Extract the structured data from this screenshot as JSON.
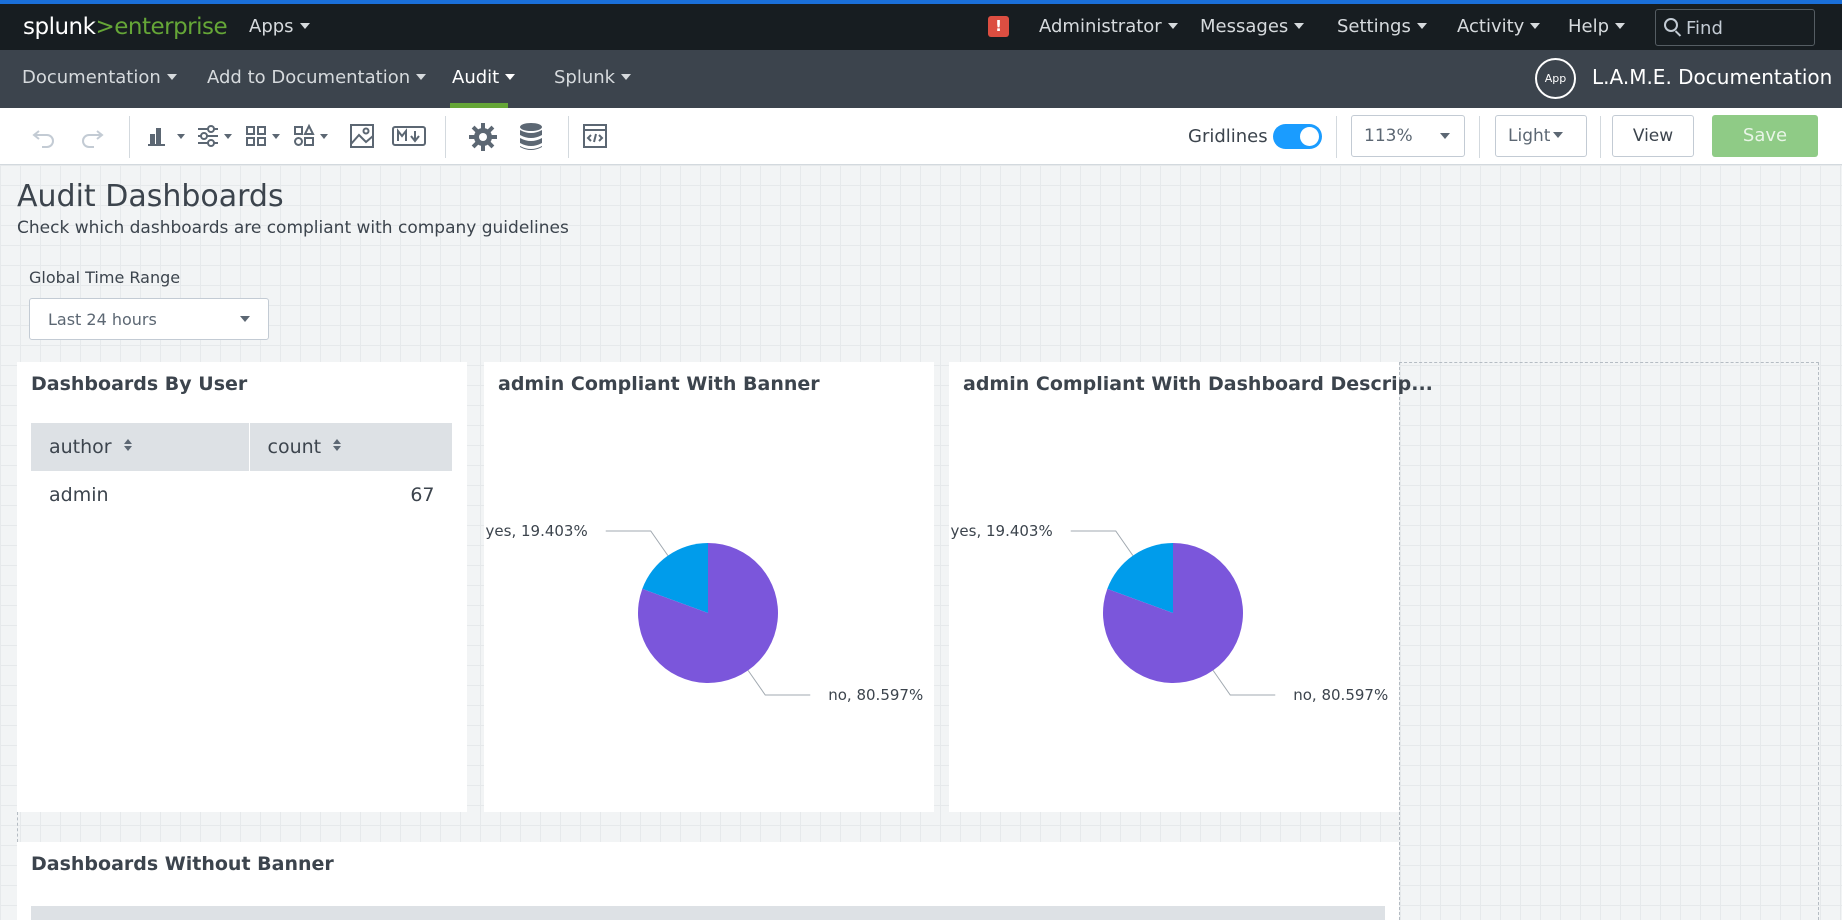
{
  "topbar": {
    "logo_splunk": "splunk",
    "logo_gt": ">",
    "logo_enterprise": "enterprise",
    "apps": "Apps",
    "alert_icon": "!",
    "administrator": "Administrator",
    "messages": "Messages",
    "settings": "Settings",
    "activity": "Activity",
    "help": "Help",
    "find_placeholder": "Find"
  },
  "appbar": {
    "items": [
      "Documentation",
      "Add to Documentation",
      "Audit",
      "Splunk"
    ],
    "active": "Audit",
    "app_badge": "App",
    "app_title": "L.A.M.E. Documentation"
  },
  "toolbar": {
    "icons": [
      "undo-icon",
      "redo-icon",
      "add-chart-icon",
      "add-input-icon",
      "layout-icon",
      "shapes-icon",
      "image-icon",
      "markdown-icon",
      "settings-icon",
      "datasource-icon",
      "source-code-icon"
    ],
    "gridlines_label": "Gridlines",
    "gridlines_on": true,
    "zoom": "113%",
    "theme": "Light",
    "view_label": "View",
    "save_label": "Save"
  },
  "dashboard": {
    "title": "Audit Dashboards",
    "description": "Check which dashboards are compliant with company guidelines",
    "time_input_label": "Global Time Range",
    "time_input_value": "Last 24 hours"
  },
  "panels": {
    "users": {
      "title": "Dashboards By User",
      "columns": [
        "author",
        "count"
      ],
      "rows": [
        [
          "admin",
          "67"
        ]
      ]
    },
    "banner": {
      "title": "admin Compliant With Banner"
    },
    "description": {
      "title": "admin Compliant With Dashboard Descrip..."
    },
    "without_banner": {
      "title": "Dashboards Without Banner"
    }
  },
  "colors": {
    "yes": "#009ceb",
    "no": "#7b56db",
    "accent": "#65a637"
  },
  "chart_data": [
    {
      "type": "pie",
      "title": "admin Compliant With Banner",
      "categories": [
        "yes",
        "no"
      ],
      "values": [
        19.403,
        80.597
      ],
      "labels": [
        "yes, 19.403%",
        "no, 80.597%"
      ]
    },
    {
      "type": "pie",
      "title": "admin Compliant With Dashboard Descrip...",
      "categories": [
        "yes",
        "no"
      ],
      "values": [
        19.403,
        80.597
      ],
      "labels": [
        "yes, 19.403%",
        "no, 80.597%"
      ]
    }
  ]
}
